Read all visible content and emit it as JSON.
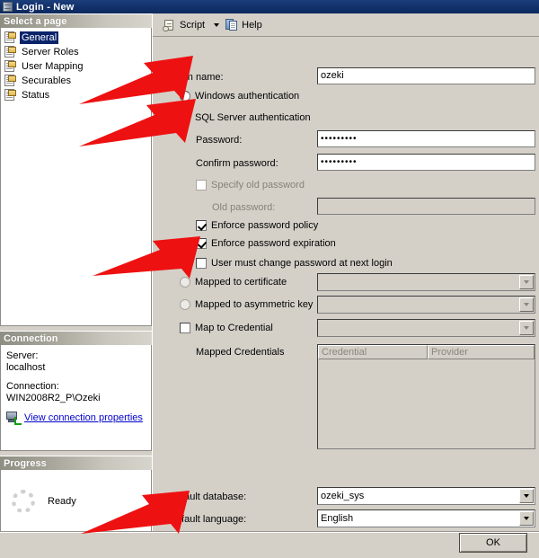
{
  "window": {
    "title": "Login - New",
    "icon": "server-icon"
  },
  "sidebar": {
    "select_page_header": "Select a page",
    "pages": [
      {
        "label": "General",
        "icon": "page-icon",
        "selected": true
      },
      {
        "label": "Server Roles",
        "icon": "page-icon",
        "selected": false
      },
      {
        "label": "User Mapping",
        "icon": "page-icon",
        "selected": false
      },
      {
        "label": "Securables",
        "icon": "page-icon",
        "selected": false
      },
      {
        "label": "Status",
        "icon": "page-icon",
        "selected": false
      }
    ],
    "connection": {
      "header": "Connection",
      "server_label": "Server:",
      "server_value": "localhost",
      "connection_label": "Connection:",
      "connection_value": "WIN2008R2_P\\Ozeki",
      "link_text": "View connection properties",
      "link_icon": "connection-properties-icon"
    },
    "progress": {
      "header": "Progress",
      "status": "Ready",
      "spinner_icon": "progress-spinner-icon"
    }
  },
  "toolbar": {
    "script_label": "Script",
    "script_icon": "script-scroll-icon",
    "script_caret_icon": "chevron-down-icon",
    "help_label": "Help",
    "help_icon": "help-document-icon"
  },
  "form": {
    "login_name_label": "Login name:",
    "login_name_value": "ozeki",
    "windows_auth_label": "Windows authentication",
    "windows_auth_checked": false,
    "sql_auth_label": "SQL Server authentication",
    "sql_auth_checked": true,
    "password_label": "Password:",
    "password_value": "•••••••••",
    "confirm_password_label": "Confirm password:",
    "confirm_password_value": "•••••••••",
    "specify_old_password_label": "Specify old password",
    "specify_old_password_checked": false,
    "old_password_label": "Old password:",
    "old_password_value": "",
    "enforce_policy_label": "Enforce password policy",
    "enforce_policy_checked": true,
    "enforce_expiration_label": "Enforce password expiration",
    "enforce_expiration_checked": true,
    "must_change_label": "User must change password at next login",
    "must_change_checked": false,
    "mapped_certificate_label": "Mapped to certificate",
    "mapped_certificate_checked": false,
    "mapped_certificate_value": "",
    "mapped_asymmetric_label": "Mapped to asymmetric key",
    "mapped_asymmetric_checked": false,
    "mapped_asymmetric_value": "",
    "map_credential_label": "Map to Credential",
    "map_credential_checked": false,
    "map_credential_value": "",
    "mapped_credentials_label": "Mapped Credentials",
    "grid_col_credential": "Credential",
    "grid_col_provider": "Provider",
    "default_database_label": "Default database:",
    "default_database_value": "ozeki_sys",
    "default_language_label": "Default language:",
    "default_language_value": "English"
  },
  "buttons": {
    "ok_label": "OK"
  },
  "annotations": {
    "arrow_color": "#ee1111",
    "arrows": [
      {
        "name": "arrow-to-login-name"
      },
      {
        "name": "arrow-to-sql-server-authentication"
      },
      {
        "name": "arrow-to-user-must-change-password"
      },
      {
        "name": "arrow-to-default-database"
      }
    ]
  }
}
